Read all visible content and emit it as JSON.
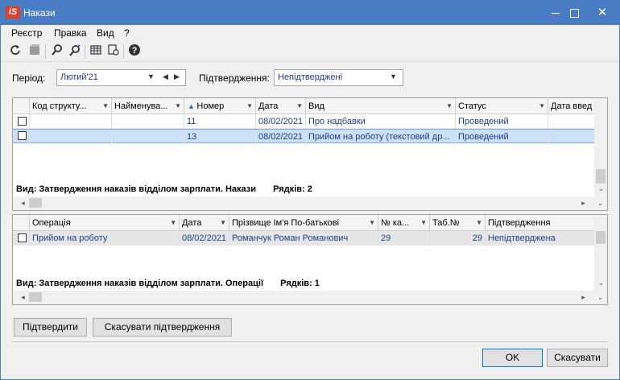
{
  "window": {
    "title": "Накази",
    "logo": "IS",
    "minimize": "minimize-icon",
    "maximize": "maximize-icon",
    "close": "✕"
  },
  "menu": [
    "Реєстр",
    "Правка",
    "Вид",
    "?"
  ],
  "toolbar": {
    "icons": [
      "refresh-icon",
      "stop-icon",
      "search-icon",
      "search-next-icon",
      "table-icon",
      "print-preview-icon",
      "help-icon"
    ]
  },
  "filters": {
    "period_label": "Період:",
    "period_value": "Лютий'21",
    "confirm_label": "Підтвердження:",
    "confirm_value": "Непідтверджені"
  },
  "orders_grid": {
    "columns": [
      "Код структу...",
      "Найменува...",
      "Номер",
      "Дата",
      "Вид",
      "Статус",
      "Дата введ"
    ],
    "rows": [
      {
        "code": "",
        "name": "",
        "number": "11",
        "date": "08/02/2021",
        "type": "Про надбавки",
        "status": "Проведений",
        "entry_date": ""
      },
      {
        "code": "",
        "name": "",
        "number": "13",
        "date": "08/02/2021",
        "type": "Прийом на роботу (текстовий др...",
        "status": "Проведений",
        "entry_date": ""
      }
    ],
    "footer_view": "Вид: Затвердження наказів відділом зарплати. Накази",
    "footer_rows": "Рядків: 2"
  },
  "ops_grid": {
    "columns": [
      "Операція",
      "Дата",
      "Прізвище Ім'я По-батькові",
      "№ ка...",
      "Таб.№",
      "Підтвердження"
    ],
    "rows": [
      {
        "operation": "Прийом на роботу",
        "date": "08/02/2021",
        "person": "Романчук Роман Романович",
        "card": "29",
        "tab": "29",
        "confirm": "Непідтверджена"
      }
    ],
    "footer_view": "Вид: Затвердження наказів відділом зарплати. Операції",
    "footer_rows": "Рядків: 1"
  },
  "buttons": {
    "confirm": "Підтвердити",
    "cancel_confirm": "Скасувати підтвердження",
    "ok": "OK",
    "cancel": "Скасувати"
  }
}
